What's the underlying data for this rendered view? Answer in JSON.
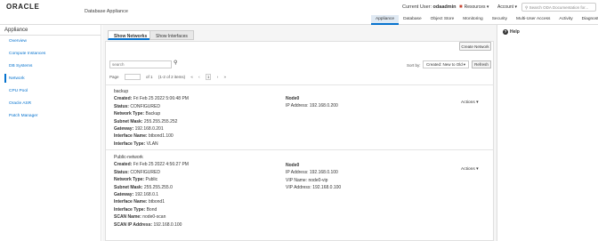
{
  "header": {
    "logo": "ORACLE",
    "app_title": "Database Appliance",
    "current_user_label": "Current User:",
    "current_user": "odaadmin",
    "resources_label": "Resources",
    "account_label": "Account",
    "search_placeholder": "Search ODA Documentation for...",
    "nav_tabs": [
      "Appliance",
      "Database",
      "Object Store",
      "Monitoring",
      "Security",
      "Multi-User Access",
      "Activity",
      "Diagnostics"
    ],
    "active_tab": "Appliance"
  },
  "sidebar": {
    "title": "Appliance",
    "items": [
      "Overview",
      "Compute Instances",
      "DB Systems",
      "Network",
      "CPU Pool",
      "Oracle ASR",
      "Patch Manager"
    ],
    "active_item": "Network"
  },
  "main": {
    "subtabs": [
      "Show Networks",
      "Show Interfaces"
    ],
    "active_subtab": "Show Networks",
    "create_button": "Create Network",
    "search_placeholder": "search",
    "pager": {
      "page_label": "Page",
      "of_label": "of 1",
      "range_label": "(1-2 of 2 items)",
      "current_page": "1"
    },
    "sort_label": "Sort by:",
    "sort_value": "Created: New to Old",
    "refresh_label": "Refresh",
    "networks": [
      {
        "name": "backup",
        "fields": [
          {
            "label": "Created:",
            "value": "Fri Feb 25 2022 5:06:48 PM"
          },
          {
            "label": "Status:",
            "value": "CONFIGURED"
          },
          {
            "label": "Network Type:",
            "value": "Backup"
          },
          {
            "label": "Subnet Mask:",
            "value": "255.255.255.252"
          },
          {
            "label": "Gateway:",
            "value": "192.168.0.201"
          },
          {
            "label": "Interface Name:",
            "value": "btbond1.100"
          },
          {
            "label": "Interface Type:",
            "value": "VLAN"
          }
        ],
        "node": {
          "name": "Node0",
          "lines": [
            "IP Address: 192.168.0.200"
          ]
        },
        "actions": "Actions"
      },
      {
        "name": "Public-network",
        "fields": [
          {
            "label": "Created:",
            "value": "Fri Feb 25 2022 4:56:27 PM"
          },
          {
            "label": "Status:",
            "value": "CONFIGURED"
          },
          {
            "label": "Network Type:",
            "value": "Public"
          },
          {
            "label": "Subnet Mask:",
            "value": "255.255.255.0"
          },
          {
            "label": "Gateway:",
            "value": "192.168.0.1"
          },
          {
            "label": "Interface Name:",
            "value": "btbond1"
          },
          {
            "label": "Interface Type:",
            "value": "Bond"
          },
          {
            "label": "SCAN Name:",
            "value": "node0-scan"
          },
          {
            "label": "SCAN IP Address:",
            "value": "192.168.0.100"
          }
        ],
        "node": {
          "name": "Node0",
          "lines": [
            "IP Address: 192.168.0.100",
            "VIP Name: node0-vip",
            "VIP Address: 192.168.0.100"
          ]
        },
        "actions": "Actions"
      }
    ]
  },
  "help": {
    "label": "Help"
  },
  "colors": {
    "accent": "#0572ce",
    "brand": "#c74634"
  }
}
